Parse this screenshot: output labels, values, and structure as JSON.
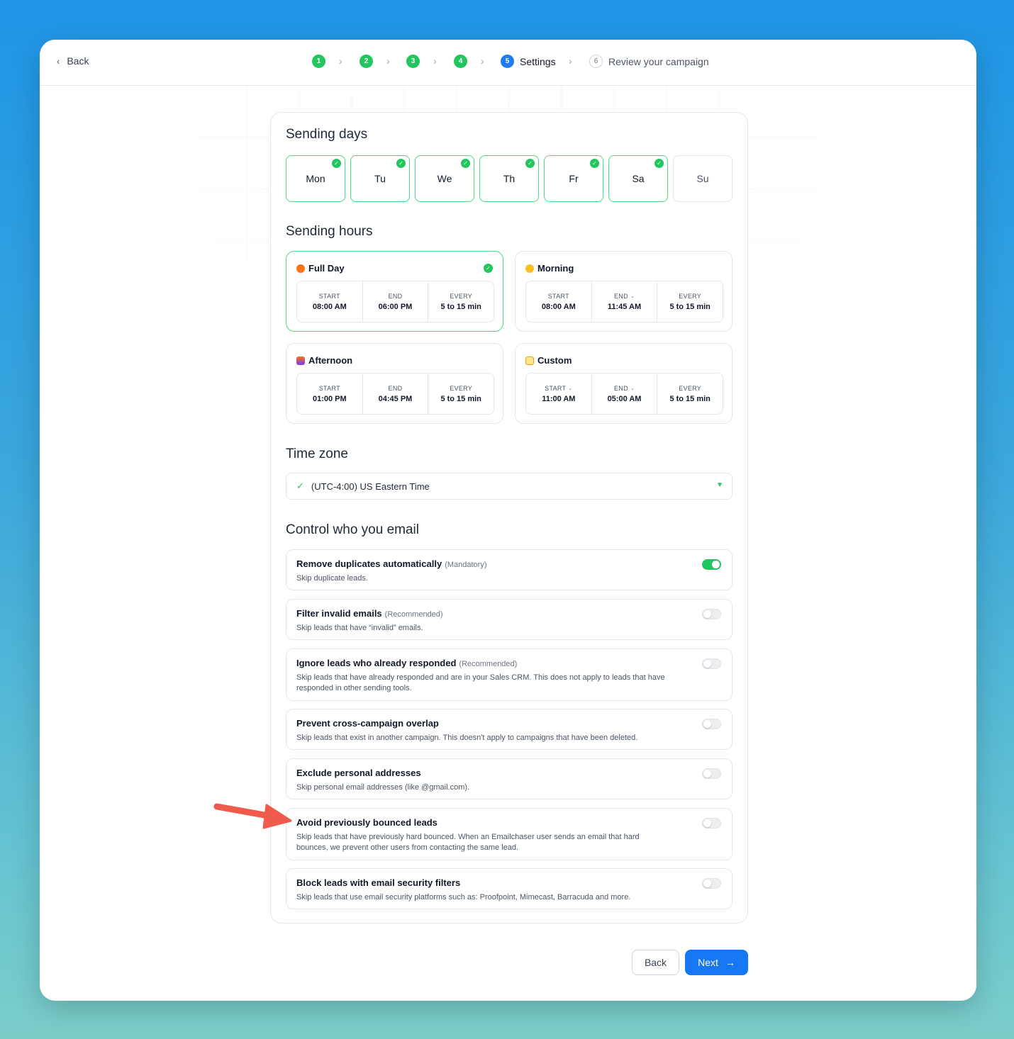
{
  "topbar": {
    "back_label": "Back"
  },
  "stepper": {
    "steps": [
      {
        "number": "1",
        "state": "done",
        "label": ""
      },
      {
        "number": "2",
        "state": "done",
        "label": ""
      },
      {
        "number": "3",
        "state": "done",
        "label": ""
      },
      {
        "number": "4",
        "state": "done",
        "label": ""
      },
      {
        "number": "5",
        "state": "active",
        "label": "Settings"
      },
      {
        "number": "6",
        "state": "pending",
        "label": "Review your campaign"
      }
    ],
    "separator": "›"
  },
  "sending_days": {
    "title": "Sending days",
    "days": [
      {
        "label": "Mon",
        "selected": true
      },
      {
        "label": "Tu",
        "selected": true
      },
      {
        "label": "We",
        "selected": true
      },
      {
        "label": "Th",
        "selected": true
      },
      {
        "label": "Fr",
        "selected": true
      },
      {
        "label": "Sa",
        "selected": true
      },
      {
        "label": "Su",
        "selected": false
      }
    ]
  },
  "sending_hours": {
    "title": "Sending hours",
    "options": [
      {
        "name": "Full Day",
        "icon": "alarm-clock-icon",
        "selected": true,
        "start_label": "START",
        "start": "08:00 AM",
        "end_label": "END",
        "end": "06:00 PM",
        "every_label": "EVERY",
        "every": "5 to 15 min"
      },
      {
        "name": "Morning",
        "icon": "sunrise-icon",
        "selected": false,
        "start_label": "START",
        "start": "08:00 AM",
        "end_label": "END",
        "end": "11:45 AM",
        "every_label": "EVERY",
        "every": "5 to 15 min"
      },
      {
        "name": "Afternoon",
        "icon": "sunset-icon",
        "selected": false,
        "start_label": "START",
        "start": "01:00 PM",
        "end_label": "END",
        "end": "04:45 PM",
        "every_label": "EVERY",
        "every": "5 to 15 min"
      },
      {
        "name": "Custom",
        "icon": "memo-icon",
        "selected": false,
        "start_label": "START",
        "start": "11:00 AM",
        "end_label": "END",
        "end": "05:00 AM",
        "every_label": "EVERY",
        "every": "5 to 15 min"
      }
    ]
  },
  "time_zone": {
    "title": "Time zone",
    "value": "(UTC-4:00) US Eastern Time"
  },
  "control": {
    "title": "Control who you email",
    "options": [
      {
        "title": "Remove duplicates automatically",
        "tag": "(Mandatory)",
        "desc": "Skip duplicate leads.",
        "enabled": true
      },
      {
        "title": "Filter invalid emails",
        "tag": "(Recommended)",
        "desc": "Skip leads that have “invalid” emails.",
        "enabled": false
      },
      {
        "title": "Ignore leads who already responded",
        "tag": "(Recommended)",
        "desc": "Skip leads that have already responded and are in your Sales CRM. This does not apply to leads that have responded in other sending tools.",
        "enabled": false
      },
      {
        "title": "Prevent cross-campaign overlap",
        "tag": "",
        "desc": "Skip leads that exist in another campaign. This doesn't apply to campaigns that have been deleted.",
        "enabled": false
      },
      {
        "title": "Exclude personal addresses",
        "tag": "",
        "desc": "Skip personal email addresses (like @gmail.com).",
        "enabled": false
      },
      {
        "title": "Avoid previously bounced leads",
        "tag": "",
        "desc": "Skip leads that have previously hard bounced. When an Emailchaser user sends an email that hard bounces, we prevent other users from contacting the same lead.",
        "enabled": false
      },
      {
        "title": "Block leads with email security filters",
        "tag": "",
        "desc": "Skip leads that use email security platforms such as: Proofpoint, Mimecast, Barracuda and more.",
        "enabled": false
      }
    ]
  },
  "footer": {
    "back_label": "Back",
    "next_label": "Next"
  },
  "colors": {
    "accent_green": "#22c55e",
    "primary_blue": "#1677f2",
    "annotation_red": "#ef5a4c"
  }
}
